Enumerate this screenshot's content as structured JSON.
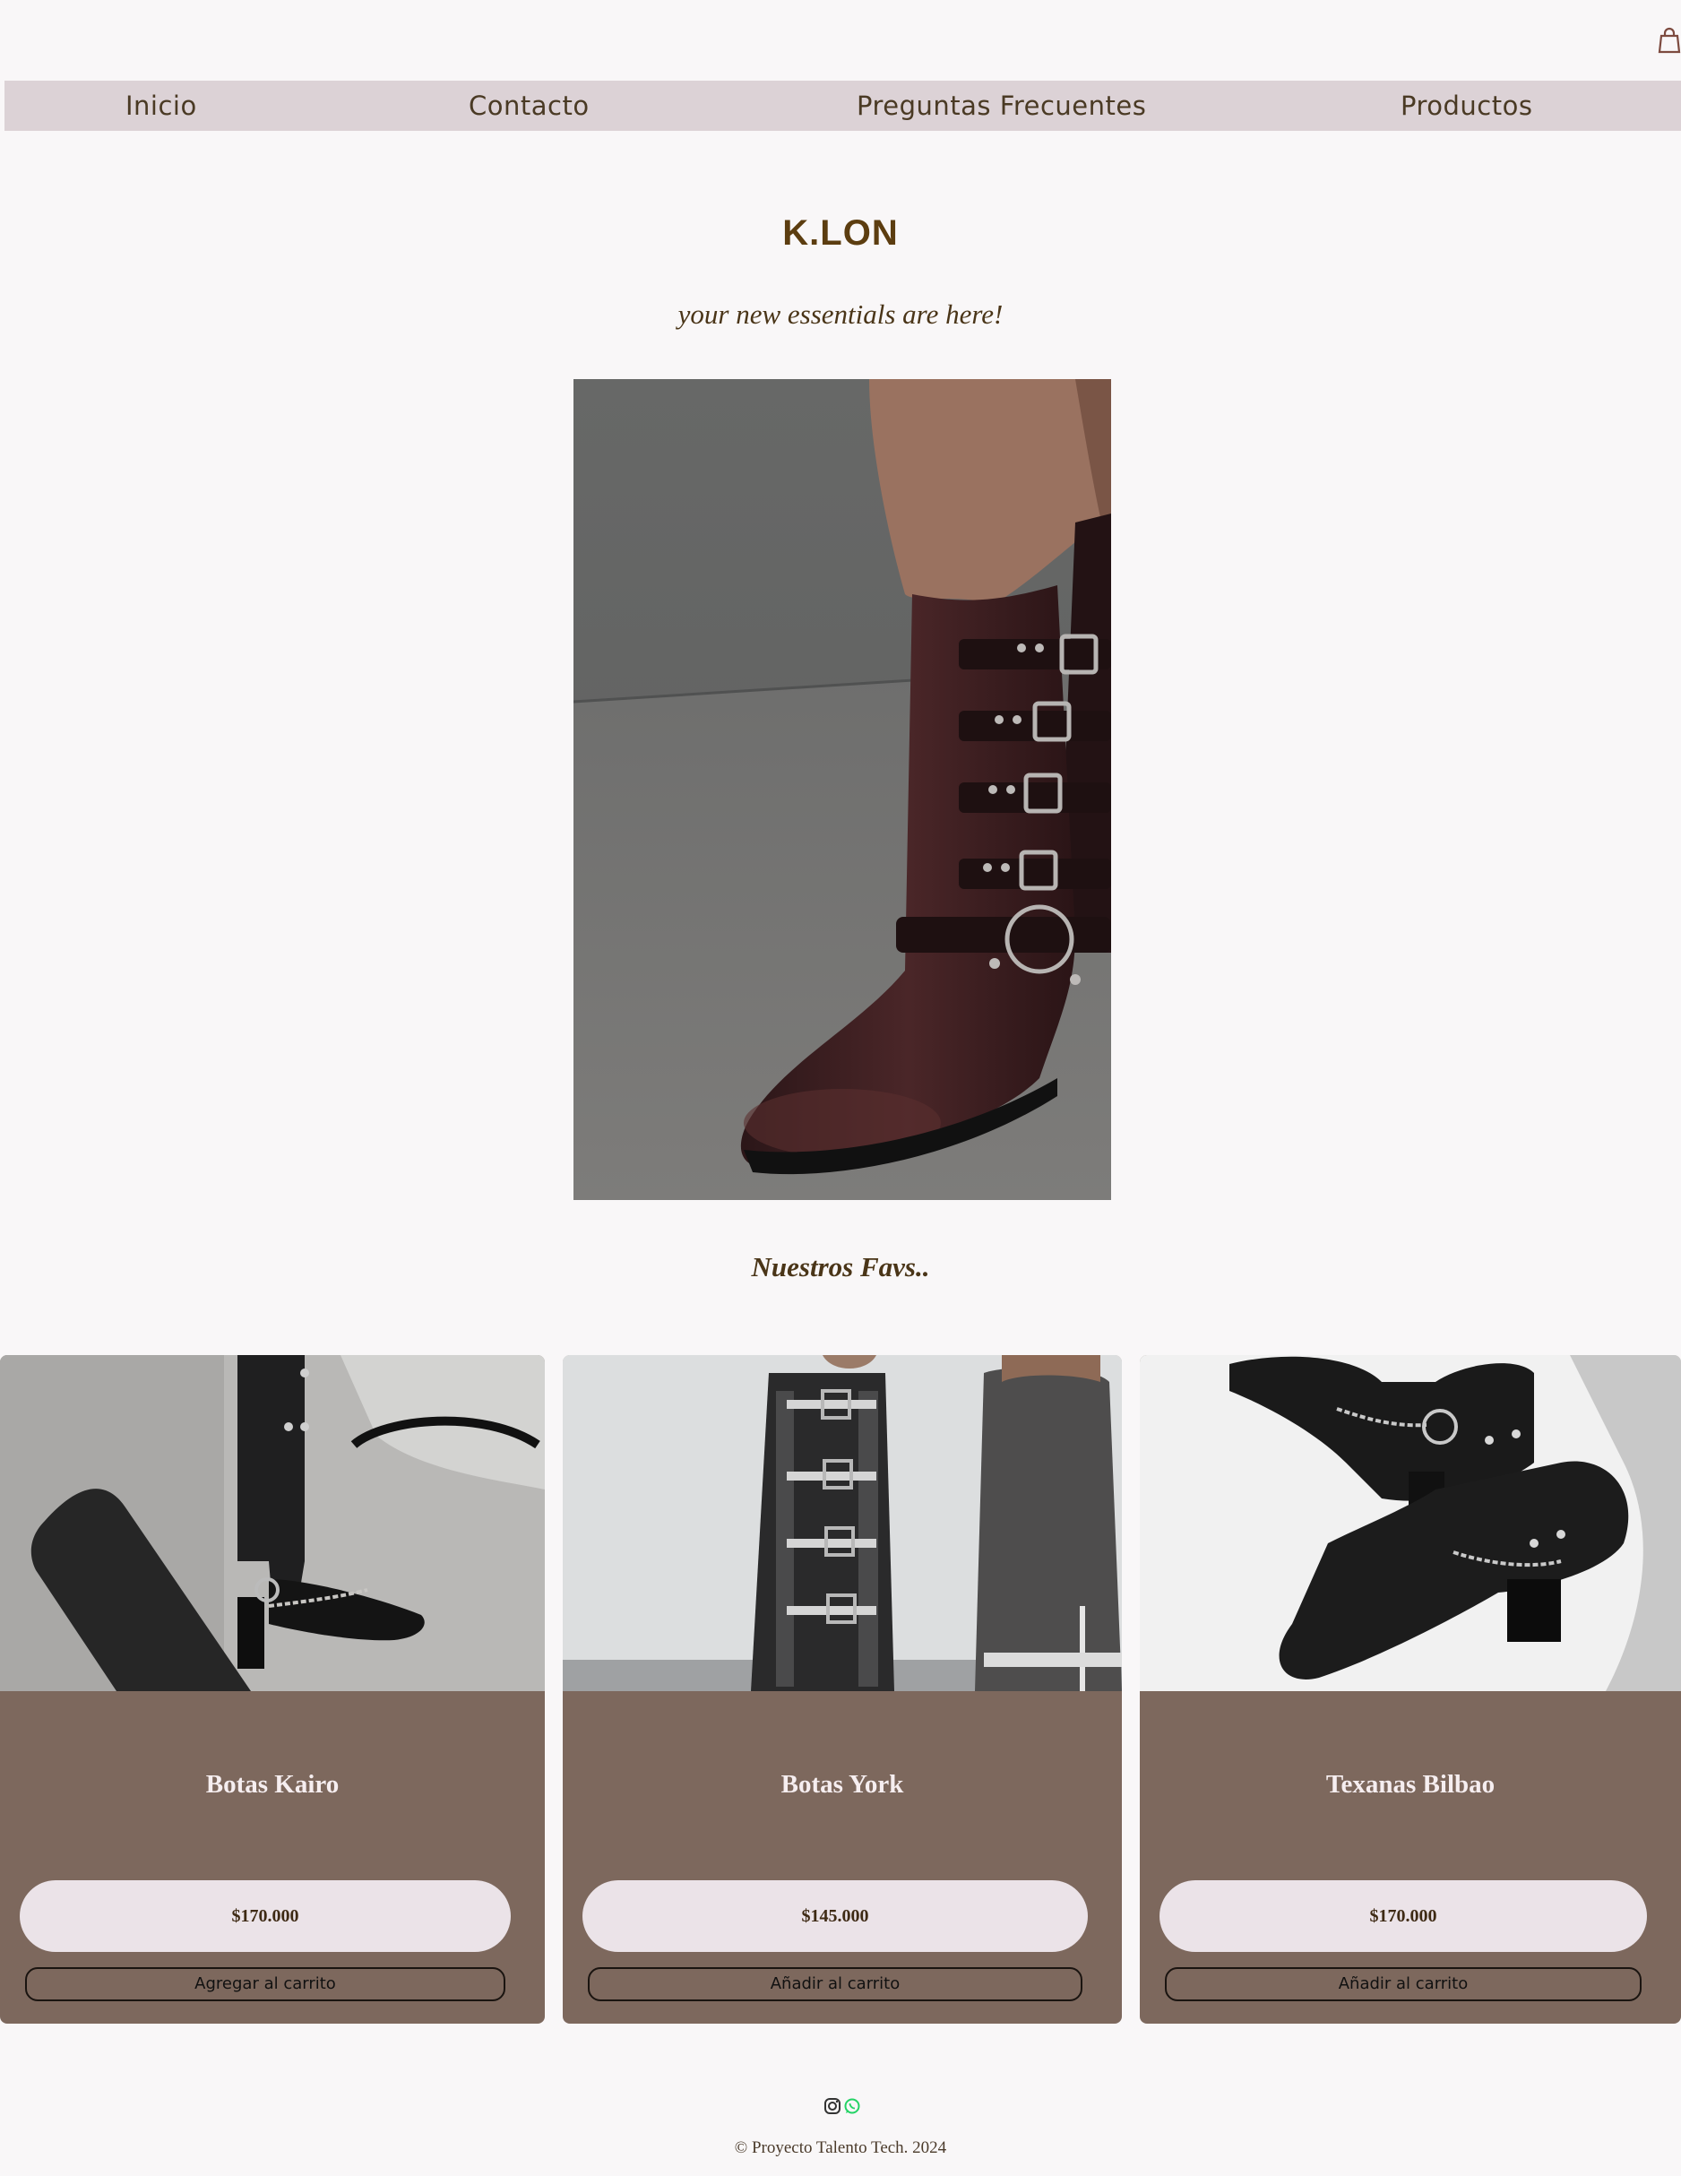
{
  "header": {
    "cart_icon": "shopping-bag-icon"
  },
  "nav": {
    "items": [
      {
        "label": "Inicio"
      },
      {
        "label": "Contacto"
      },
      {
        "label": "Preguntas Frecuentes"
      },
      {
        "label": "Productos"
      }
    ]
  },
  "hero": {
    "brand": "K.LON",
    "tagline": "your new essentials are here!"
  },
  "favorites": {
    "heading": "Nuestros Favs..",
    "products": [
      {
        "name": "Botas Kairo",
        "price": "$170.000",
        "button": "Agregar al carrito"
      },
      {
        "name": "Botas York",
        "price": "$145.000",
        "button": "Añadir al carrito"
      },
      {
        "name": "Texanas Bilbao",
        "price": "$170.000",
        "button": "Añadir al carrito"
      }
    ]
  },
  "footer": {
    "icons": [
      "instagram-icon",
      "whatsapp-icon"
    ],
    "copyright": "© Proyecto Talento Tech. 2024"
  },
  "colors": {
    "nav_bg": "#dcd2d6",
    "brand": "#5c3d10",
    "card_bg": "#7d685d",
    "price_pill": "#ebe3e8",
    "page_bg": "#f9f7f8",
    "whatsapp": "#25d366"
  }
}
